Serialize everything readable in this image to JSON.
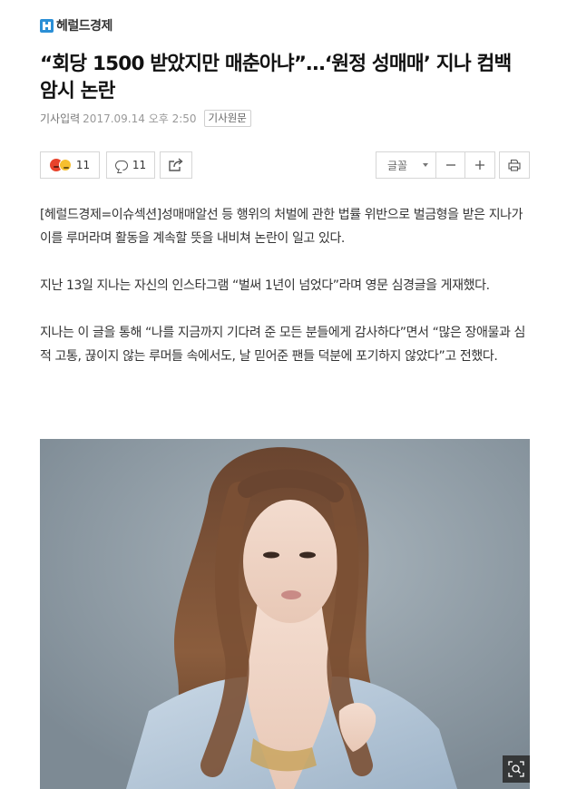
{
  "masthead": {
    "logo_text": "헤럴드경제",
    "logo_color": "#2b8fd6"
  },
  "article": {
    "headline": "“회당 1500 받았지만 매춘아냐”…‘원정 성매매’ 지나 컴백 암시 논란",
    "meta_label": "기사입력",
    "meta_date": "2017.09.14 오후 2:50",
    "original_button": "기사원문",
    "paragraphs": [
      "[헤럴드경제=이슈섹션]성매매알선 등 행위의 처벌에 관한 법률 위반으로 벌금형을 받은 지나가 이를 루머라며 활동을 계속할 뜻을 내비쳐 논란이 일고 있다.",
      "지난 13일 지나는 자신의 인스타그램 “벌써 1년이 넘었다”라며 영문 심경글을 게재했다.",
      "지나는 이 글을 통해 “나를 지금까지 기다려 준 모든 분들에게 감사하다”면서 “많은 장애물과 심적 고통, 끊이지 않는 루머들 속에서도, 날 믿어준 팬들 덕분에 포기하지 않았다”고 전했다."
    ]
  },
  "toolbar": {
    "reaction_count": "11",
    "comment_count": "11",
    "font_label": "글꼴",
    "icons": [
      "angry-emoji-icon",
      "sad-emoji-icon",
      "comment-icon",
      "share-icon",
      "minus-icon",
      "plus-icon",
      "print-icon"
    ]
  },
  "photo": {
    "zoom_icon": "zoom-icon",
    "background_color": "#8e9ba5"
  }
}
